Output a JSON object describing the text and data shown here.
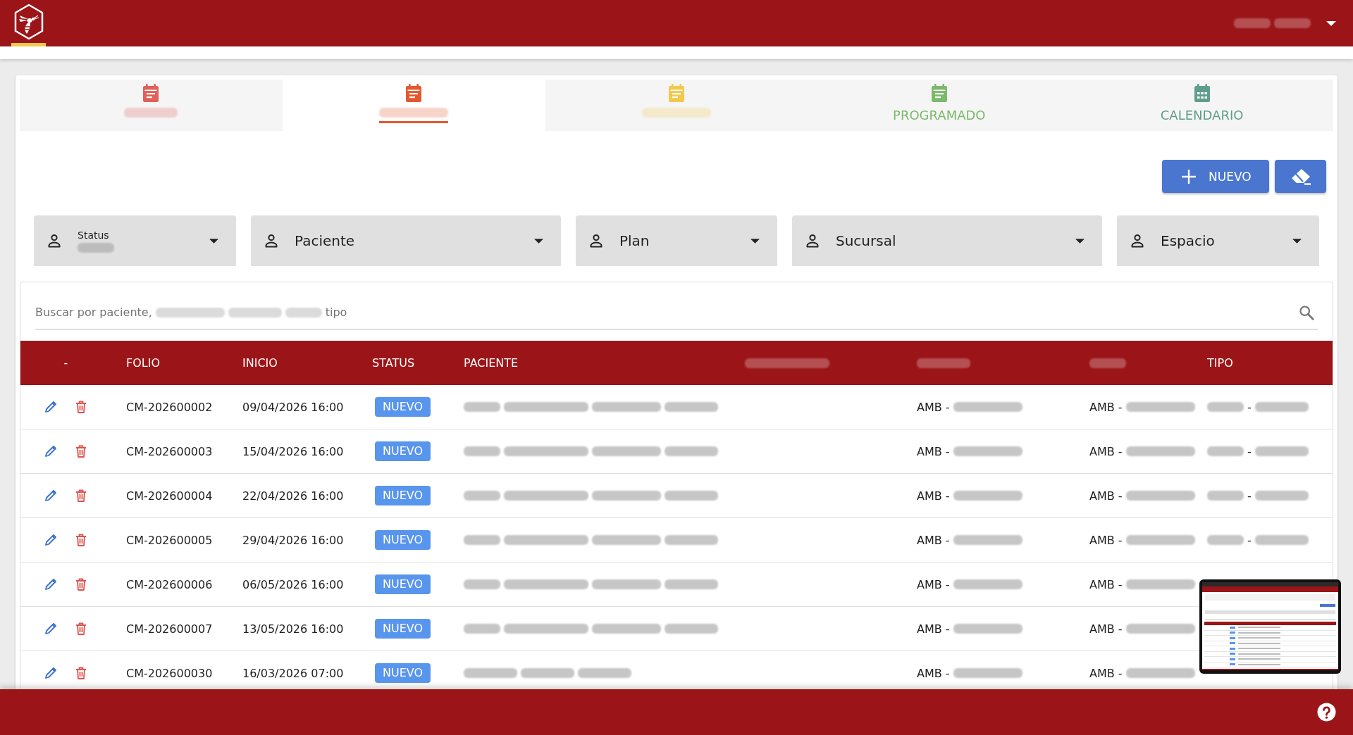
{
  "header": {
    "home_selected": true,
    "user": [
      {
        "kind": "blur_s"
      },
      {
        "kind": "blur_s"
      }
    ]
  },
  "tabs": [
    {
      "label": [
        {
          "kind": "blur_m"
        }
      ],
      "selected": false,
      "color": "#e0605a"
    },
    {
      "label": [
        {
          "kind": "blur_l"
        }
      ],
      "selected": true,
      "color": "#e2582f"
    },
    {
      "label": [
        {
          "kind": "blur_l"
        }
      ],
      "selected": false,
      "color": "#f2c94c"
    },
    {
      "label": [
        {
          "kind": "text",
          "text": "PROGRAMADO"
        }
      ],
      "selected": false,
      "color": "#7cb96a"
    },
    {
      "label": [
        {
          "kind": "text",
          "text": "CALENDARIO"
        }
      ],
      "selected": false,
      "color": "#5f9e8c"
    }
  ],
  "actions": {
    "new_button": "NUEVO"
  },
  "filters": [
    {
      "label": "Status",
      "value": [
        {
          "kind": "blur_s"
        }
      ]
    },
    {
      "label": "Paciente"
    },
    {
      "label": "Plan"
    },
    {
      "label": "Sucursal"
    },
    {
      "label": "Espacio"
    }
  ],
  "search": {
    "placeholder": [
      {
        "kind": "text",
        "text": "Buscar por paciente,"
      },
      {
        "kind": "blur_l"
      },
      {
        "kind": "blur_m"
      },
      {
        "kind": "blur_s"
      },
      {
        "kind": "text",
        "text": "tipo"
      }
    ]
  },
  "table": {
    "columns": [
      {
        "label": [
          {
            "kind": "text",
            "text": "-"
          }
        ]
      },
      {
        "label": [
          {
            "kind": "text",
            "text": "FOLIO"
          }
        ]
      },
      {
        "label": [
          {
            "kind": "text",
            "text": "INICIO"
          }
        ]
      },
      {
        "label": [
          {
            "kind": "text",
            "text": "STATUS"
          }
        ]
      },
      {
        "label": [
          {
            "kind": "text",
            "text": "PACIENTE"
          }
        ]
      },
      {
        "label": [
          {
            "kind": "blur_xl"
          }
        ]
      },
      {
        "label": [
          {
            "kind": "blur_m"
          }
        ]
      },
      {
        "label": [
          {
            "kind": "blur_s"
          }
        ]
      },
      {
        "label": [
          {
            "kind": "text",
            "text": "TIPO"
          }
        ]
      }
    ],
    "rows": [
      {
        "folio": "CM-202600002",
        "inicio": "09/04/2026 16:00",
        "status": "NUEVO",
        "paciente": [
          {
            "kind": "blur_s"
          },
          {
            "kind": "blur_xl"
          },
          {
            "kind": "blur_l"
          },
          {
            "kind": "blur_m"
          }
        ],
        "regimen": [
          {
            "kind": "text",
            "text": "AMB -"
          },
          {
            "kind": "blur_l"
          }
        ],
        "clase": [
          {
            "kind": "text",
            "text": "AMB -"
          },
          {
            "kind": "blur_l"
          }
        ],
        "tipo": [
          {
            "kind": "blur_s"
          },
          {
            "kind": "text",
            "text": "-"
          },
          {
            "kind": "blur_m"
          }
        ]
      },
      {
        "folio": "CM-202600003",
        "inicio": "15/04/2026 16:00",
        "status": "NUEVO",
        "paciente": [
          {
            "kind": "blur_s"
          },
          {
            "kind": "blur_xl"
          },
          {
            "kind": "blur_l"
          },
          {
            "kind": "blur_m"
          }
        ],
        "regimen": [
          {
            "kind": "text",
            "text": "AMB -"
          },
          {
            "kind": "blur_l"
          }
        ],
        "clase": [
          {
            "kind": "text",
            "text": "AMB -"
          },
          {
            "kind": "blur_l"
          }
        ],
        "tipo": [
          {
            "kind": "blur_s"
          },
          {
            "kind": "text",
            "text": "-"
          },
          {
            "kind": "blur_m"
          }
        ]
      },
      {
        "folio": "CM-202600004",
        "inicio": "22/04/2026 16:00",
        "status": "NUEVO",
        "paciente": [
          {
            "kind": "blur_s"
          },
          {
            "kind": "blur_xl"
          },
          {
            "kind": "blur_l"
          },
          {
            "kind": "blur_m"
          }
        ],
        "regimen": [
          {
            "kind": "text",
            "text": "AMB -"
          },
          {
            "kind": "blur_l"
          }
        ],
        "clase": [
          {
            "kind": "text",
            "text": "AMB -"
          },
          {
            "kind": "blur_l"
          }
        ],
        "tipo": [
          {
            "kind": "blur_s"
          },
          {
            "kind": "text",
            "text": "-"
          },
          {
            "kind": "blur_m"
          }
        ]
      },
      {
        "folio": "CM-202600005",
        "inicio": "29/04/2026 16:00",
        "status": "NUEVO",
        "paciente": [
          {
            "kind": "blur_s"
          },
          {
            "kind": "blur_xl"
          },
          {
            "kind": "blur_l"
          },
          {
            "kind": "blur_m"
          }
        ],
        "regimen": [
          {
            "kind": "text",
            "text": "AMB -"
          },
          {
            "kind": "blur_l"
          }
        ],
        "clase": [
          {
            "kind": "text",
            "text": "AMB -"
          },
          {
            "kind": "blur_l"
          }
        ],
        "tipo": [
          {
            "kind": "blur_s"
          },
          {
            "kind": "text",
            "text": "-"
          },
          {
            "kind": "blur_m"
          }
        ]
      },
      {
        "folio": "CM-202600006",
        "inicio": "06/05/2026 16:00",
        "status": "NUEVO",
        "paciente": [
          {
            "kind": "blur_s"
          },
          {
            "kind": "blur_xl"
          },
          {
            "kind": "blur_l"
          },
          {
            "kind": "blur_m"
          }
        ],
        "regimen": [
          {
            "kind": "text",
            "text": "AMB -"
          },
          {
            "kind": "blur_l"
          }
        ],
        "clase": [
          {
            "kind": "text",
            "text": "AMB -"
          },
          {
            "kind": "blur_l"
          }
        ]
      },
      {
        "folio": "CM-202600007",
        "inicio": "13/05/2026 16:00",
        "status": "NUEVO",
        "paciente": [
          {
            "kind": "blur_s"
          },
          {
            "kind": "blur_xl"
          },
          {
            "kind": "blur_l"
          },
          {
            "kind": "blur_m"
          }
        ],
        "regimen": [
          {
            "kind": "text",
            "text": "AMB -"
          },
          {
            "kind": "blur_l"
          }
        ],
        "clase": [
          {
            "kind": "text",
            "text": "AMB -"
          },
          {
            "kind": "blur_l"
          }
        ]
      },
      {
        "folio": "CM-202600030",
        "inicio": "16/03/2026 07:00",
        "status": "NUEVO",
        "paciente": [
          {
            "kind": "blur_m"
          },
          {
            "kind": "blur_m"
          },
          {
            "kind": "blur_m"
          }
        ],
        "regimen": [
          {
            "kind": "text",
            "text": "AMB -"
          },
          {
            "kind": "blur_l"
          }
        ],
        "clase": [
          {
            "kind": "text",
            "text": "AMB -"
          },
          {
            "kind": "blur_l"
          }
        ]
      }
    ]
  }
}
